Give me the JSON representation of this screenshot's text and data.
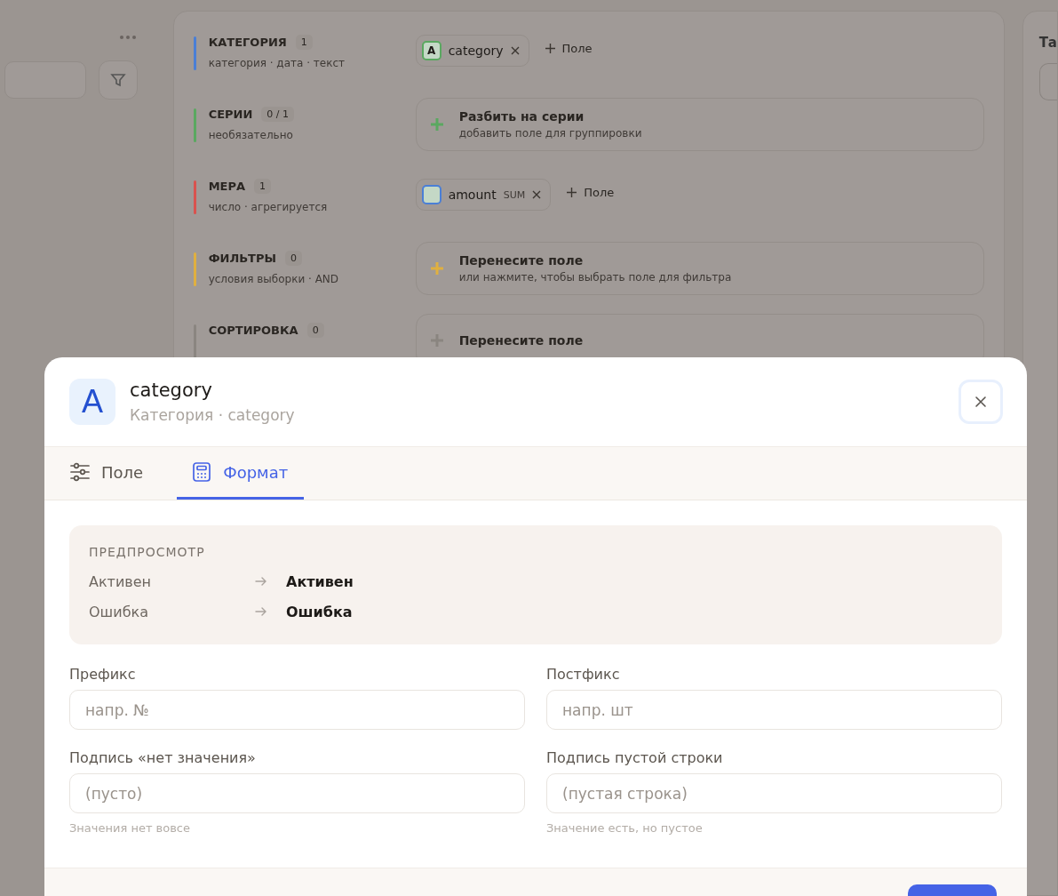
{
  "background": {
    "right_panel": {
      "title": "Та"
    },
    "sections": [
      {
        "title": "КАТЕГОРИЯ",
        "count": "1",
        "hint": "категория · дата · текст",
        "color": "#4a7fd6",
        "kind": "chips",
        "chips": [
          {
            "icon": "A",
            "label": "category",
            "color": "#5aa860"
          }
        ],
        "add": "Поле"
      },
      {
        "title": "СЕРИИ",
        "count": "0 / 1",
        "hint": "необязательно",
        "color": "#5aa860",
        "kind": "drop",
        "drop": {
          "title": "Разбить на серии",
          "hint": "добавить поле для группировки"
        }
      },
      {
        "title": "МЕРА",
        "count": "1",
        "hint": "число · агрегируется",
        "color": "#d9534f",
        "kind": "chips",
        "chips": [
          {
            "label": "amount",
            "agg": "SUM",
            "color": "#4a7fd6"
          }
        ],
        "add": "Поле"
      },
      {
        "title": "ФИЛЬТРЫ",
        "count": "0",
        "hint": "условия выборки · AND",
        "color": "#e0b040",
        "kind": "drop",
        "drop": {
          "title": "Перенесите поле",
          "hint": "или нажмите, чтобы выбрать поле для фильтра"
        }
      },
      {
        "title": "СОРТИРОВКА",
        "count": "0",
        "color": "#8a8580",
        "kind": "drop",
        "drop": {
          "title": "Перенесите поле"
        }
      }
    ]
  },
  "dialog": {
    "icon": "A",
    "title": "category",
    "subtitle": "Категория · category",
    "tabs": [
      {
        "label": "Поле",
        "kind": "field",
        "selected": false
      },
      {
        "label": "Формат",
        "kind": "format",
        "selected": true
      }
    ],
    "preview": {
      "title": "ПРЕДПРОСМОТР",
      "rows": [
        {
          "from": "Активен",
          "to": "Активен"
        },
        {
          "from": "Ошибка",
          "to": "Ошибка"
        }
      ]
    },
    "fields": [
      {
        "label": "Префикс",
        "placeholder": "напр. №"
      },
      {
        "label": "Постфикс",
        "placeholder": "напр. шт"
      },
      {
        "label": "Подпись «нет значения»",
        "placeholder": "(пусто)",
        "hint": "Значения нет вовсе"
      },
      {
        "label": "Подпись пустой строки",
        "placeholder": "(пустая строка)",
        "hint": "Значение есть, но пустое"
      }
    ]
  }
}
